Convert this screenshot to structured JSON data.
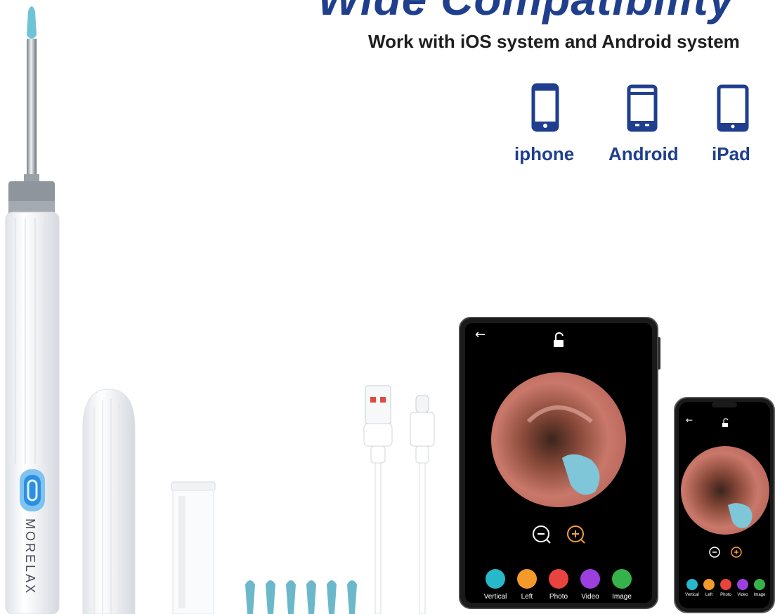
{
  "headline": "Wide Compatibility",
  "subtitle": "Work with iOS system and Android system",
  "devices": [
    {
      "label": "iphone",
      "icon": "iphone-icon"
    },
    {
      "label": "Android",
      "icon": "android-phone-icon"
    },
    {
      "label": "iPad",
      "icon": "ipad-icon"
    }
  ],
  "brand": "MORELAX",
  "app_buttons": [
    {
      "label": "Vertical",
      "color": "#27b8c9"
    },
    {
      "label": "Left",
      "color": "#f39a2b"
    },
    {
      "label": "Photo",
      "color": "#e8433d"
    },
    {
      "label": "Video",
      "color": "#9b3fe0"
    },
    {
      "label": "Image",
      "color": "#35b34a"
    }
  ],
  "colors": {
    "accent": "#1f3f8e",
    "tip": "#6fc3d6"
  }
}
